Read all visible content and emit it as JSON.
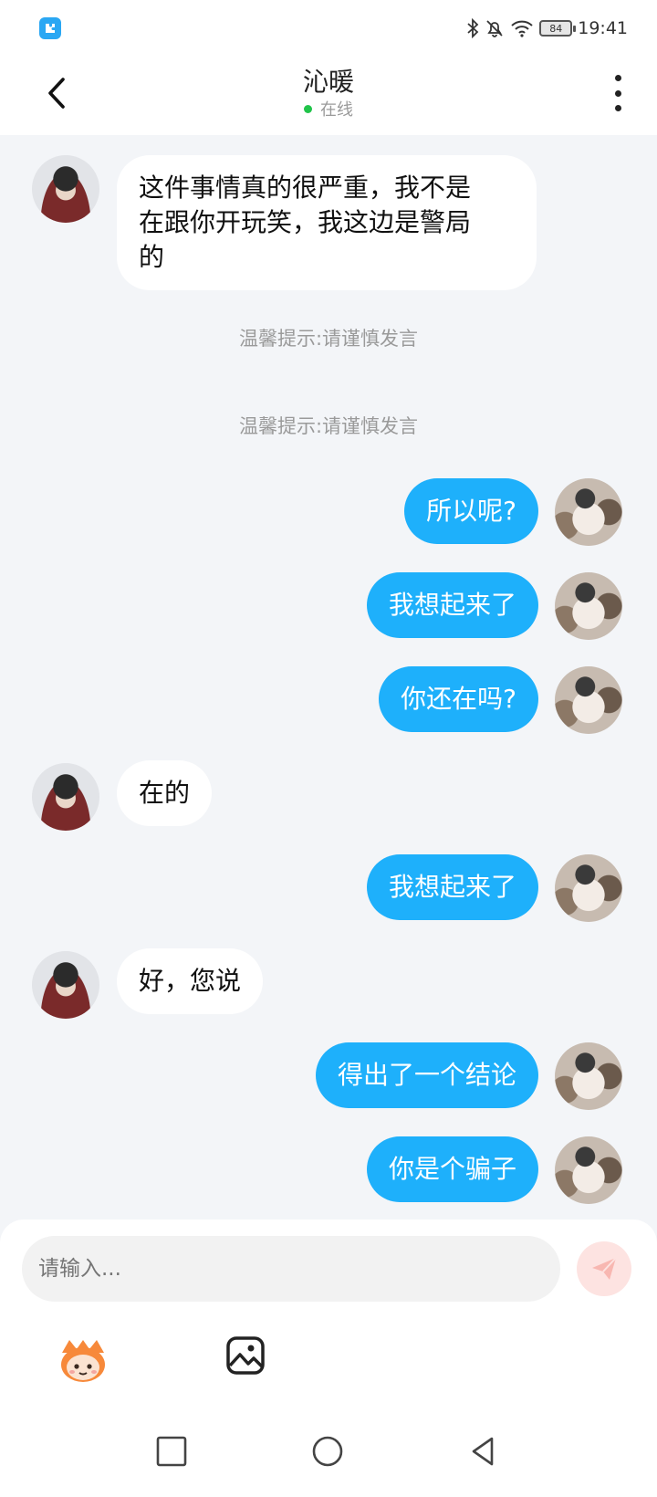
{
  "status_bar": {
    "battery": "84",
    "time": "19:41"
  },
  "header": {
    "title": "沁暖",
    "status": "在线"
  },
  "messages": [
    {
      "from": "them",
      "text_lines": [
        "这件事情真的很严重，我不是",
        "在跟你开玩笑，我这边是警局",
        "的"
      ]
    },
    {
      "type": "tip",
      "text": "温馨提示:请谨慎发言"
    },
    {
      "type": "tip",
      "text": "温馨提示:请谨慎发言"
    },
    {
      "from": "me",
      "text": "所以呢?"
    },
    {
      "from": "me",
      "text": "我想起来了"
    },
    {
      "from": "me",
      "text": "你还在吗?"
    },
    {
      "from": "them",
      "text": "在的"
    },
    {
      "from": "me",
      "text": "我想起来了"
    },
    {
      "from": "them",
      "text": "好，您说"
    },
    {
      "from": "me",
      "text": "得出了一个结论"
    },
    {
      "from": "me",
      "text": "你是个骗子"
    }
  ],
  "input": {
    "placeholder": "请输入..."
  },
  "icons": {
    "back": "chevron-left-icon",
    "more": "more-vertical-icon",
    "send": "send-icon",
    "emoji": "emoji-icon",
    "image": "image-icon",
    "nav_recent": "square-icon",
    "nav_home": "circle-icon",
    "nav_back": "triangle-back-icon"
  },
  "colors": {
    "my_bubble": "#1eb0fb",
    "their_bubble": "#ffffff",
    "background": "#f3f5f8",
    "online_dot": "#21c44a"
  }
}
